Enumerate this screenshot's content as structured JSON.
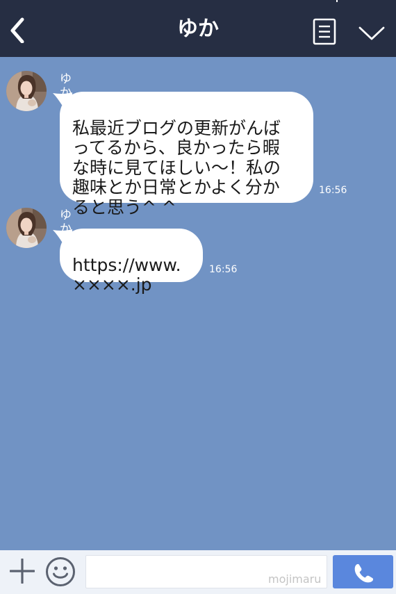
{
  "header": {
    "title": "ゆか",
    "back_icon": "chevron-left-icon",
    "menu_icon": "list-icon",
    "dropdown_icon": "chevron-down-icon"
  },
  "messages": [
    {
      "sender": "ゆか",
      "text": "私最近ブログの更新がんば\nってるから、良かったら暇\nな時に見てほしい〜！私の\n趣味とか日常とかよく分か\nると思う^ ^",
      "time": "16:56"
    },
    {
      "sender": "ゆか",
      "text": "https://www.\n××××.jp",
      "time": "16:56"
    }
  ],
  "footer": {
    "input_value": "",
    "watermark": "mojimaru",
    "plus_icon": "plus-icon",
    "emoji_icon": "smiley-icon",
    "call_icon": "phone-icon"
  },
  "colors": {
    "header_bg": "#262e43",
    "chat_bg": "#7193c4",
    "bubble_bg": "#ffffff",
    "footer_bg": "#eef2f8",
    "call_button": "#5a87dd"
  }
}
